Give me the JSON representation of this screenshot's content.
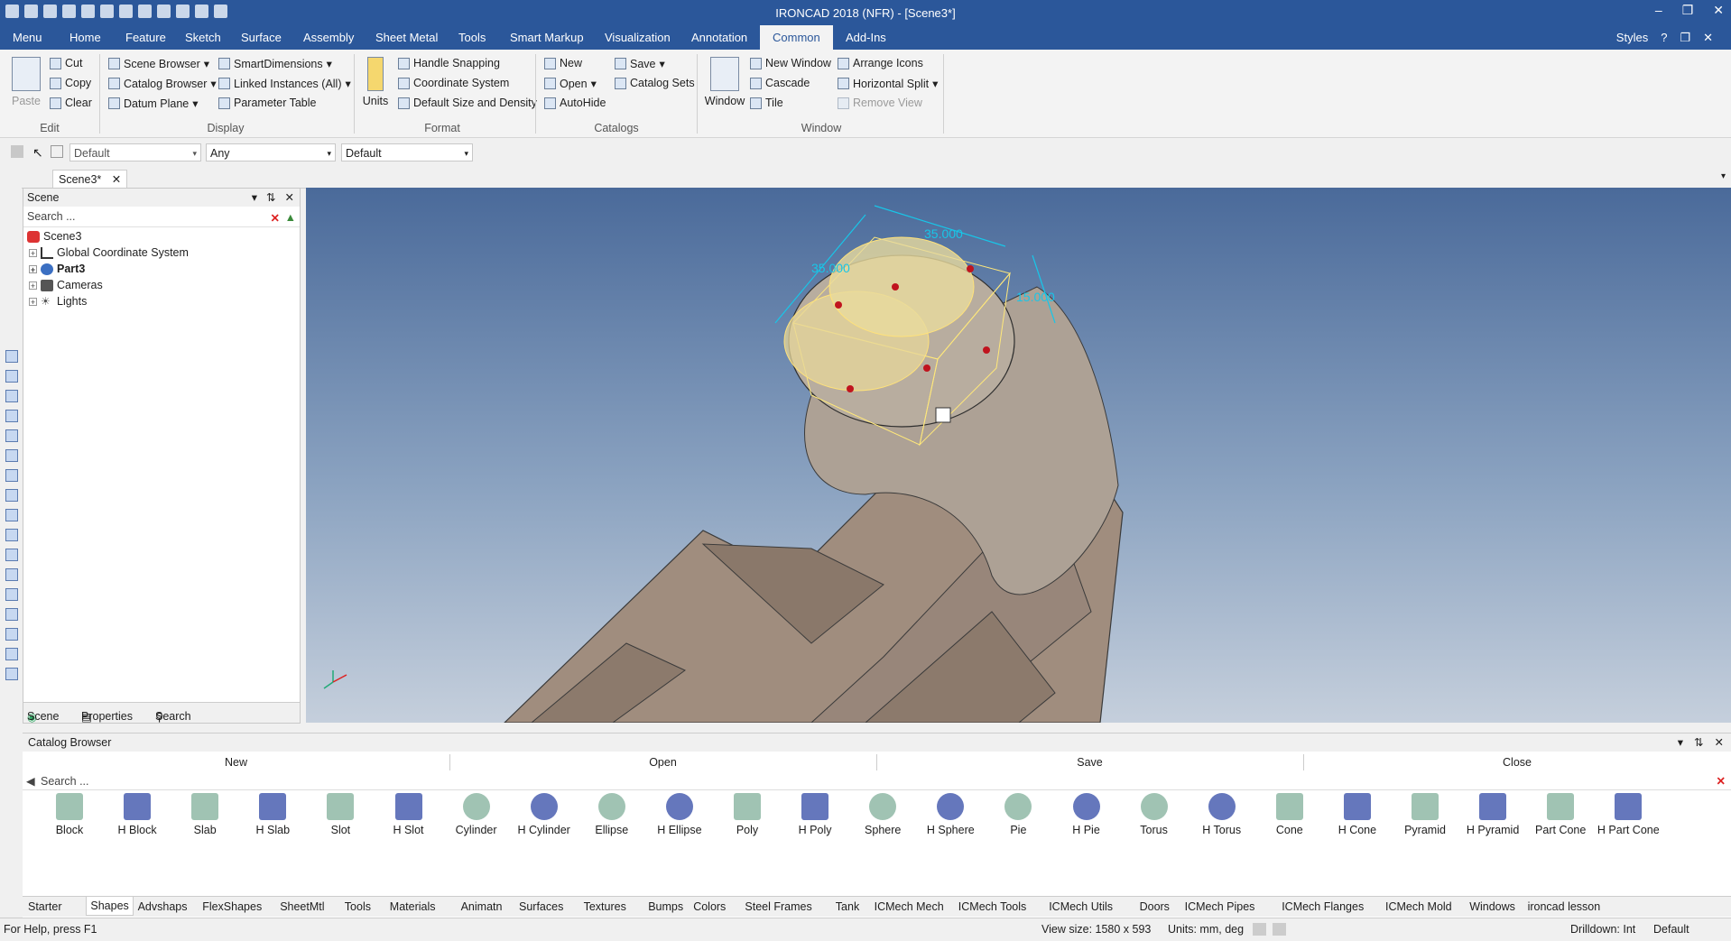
{
  "app_title": "IRONCAD 2018 (NFR) - [Scene3*]",
  "menu_tabs": [
    "Menu",
    "Home",
    "Feature",
    "Sketch",
    "Surface",
    "Assembly",
    "Sheet Metal",
    "Tools",
    "Smart Markup",
    "Visualization",
    "Annotation",
    "Common",
    "Add-Ins"
  ],
  "active_tab": "Common",
  "styles_label": "Styles",
  "ribbon": {
    "edit": {
      "paste": "Paste",
      "cut": "Cut",
      "copy": "Copy",
      "clear": "Clear",
      "group": "Edit"
    },
    "display": {
      "scene_browser": "Scene Browser",
      "catalog_browser": "Catalog Browser",
      "datum_plane": "Datum Plane",
      "smart_dimensions": "SmartDimensions",
      "linked_instances": "Linked Instances (All)",
      "parameter_table": "Parameter Table",
      "group": "Display"
    },
    "format": {
      "units": "Units",
      "handle_snapping": "Handle Snapping",
      "coordinate_system": "Coordinate System",
      "default_size": "Default Size and Density",
      "group": "Format"
    },
    "catalogs": {
      "new": "New",
      "open": "Open",
      "autohide": "AutoHide",
      "save": "Save",
      "catalog_sets": "Catalog Sets",
      "group": "Catalogs"
    },
    "window": {
      "window": "Window",
      "new_window": "New Window",
      "cascade": "Cascade",
      "tile": "Tile",
      "arrange_icons": "Arrange Icons",
      "horizontal_split": "Horizontal Split",
      "remove_view": "Remove View",
      "group": "Window"
    }
  },
  "selection": {
    "combo1": "Default",
    "combo2": "Any",
    "combo3": "Default"
  },
  "doc_tab": "Scene3*",
  "scene_panel": {
    "title": "Scene",
    "search_placeholder": "Search ...",
    "tree": [
      "Scene3",
      "Global Coordinate System",
      "Part3",
      "Cameras",
      "Lights"
    ],
    "tabs": [
      "Scene",
      "Properties",
      "Search"
    ]
  },
  "viewport": {
    "dim_top": "35.000",
    "dim_left": "35.000",
    "dim_right": "15.000"
  },
  "catalog": {
    "title": "Catalog Browser",
    "buttons": [
      "New",
      "Open",
      "Save",
      "Close"
    ],
    "search_placeholder": "Search ...",
    "items": [
      "Block",
      "H Block",
      "Slab",
      "H Slab",
      "Slot",
      "H Slot",
      "Cylinder",
      "H Cylinder",
      "Ellipse",
      "H Ellipse",
      "Poly",
      "H Poly",
      "Sphere",
      "H Sphere",
      "Pie",
      "H Pie",
      "Torus",
      "H Torus",
      "Cone",
      "H Cone",
      "Pyramid",
      "H Pyramid",
      "Part Cone",
      "H Part Cone"
    ],
    "tabs": [
      "Starter",
      "Shapes",
      "Advshaps",
      "FlexShapes",
      "SheetMtl",
      "Tools",
      "Materials",
      "Animatn",
      "Surfaces",
      "Textures",
      "Bumps",
      "Colors",
      "Steel Frames",
      "Tank",
      "ICMech Mech",
      "ICMech Tools",
      "ICMech Utils",
      "Doors",
      "ICMech  Pipes",
      "ICMech Flanges",
      "ICMech Mold",
      "Windows",
      "ironcad lesson"
    ],
    "active_tab": "Shapes"
  },
  "status": {
    "help": "For Help, press F1",
    "view_size": "View size: 1580 x 593",
    "units": "Units: mm, deg",
    "drilldown": "Drilldown: Int",
    "style": "Default"
  }
}
